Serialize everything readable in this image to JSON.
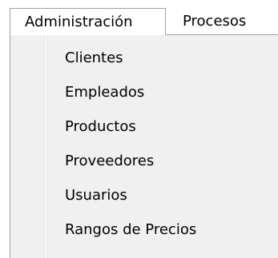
{
  "menubar": {
    "items": [
      {
        "label": "Administración"
      },
      {
        "label": "Procesos"
      }
    ]
  },
  "dropdown": {
    "items": [
      {
        "label": "Clientes"
      },
      {
        "label": "Empleados"
      },
      {
        "label": "Productos"
      },
      {
        "label": "Proveedores"
      },
      {
        "label": "Usuarios"
      },
      {
        "label": "Rangos de Precios"
      }
    ]
  }
}
